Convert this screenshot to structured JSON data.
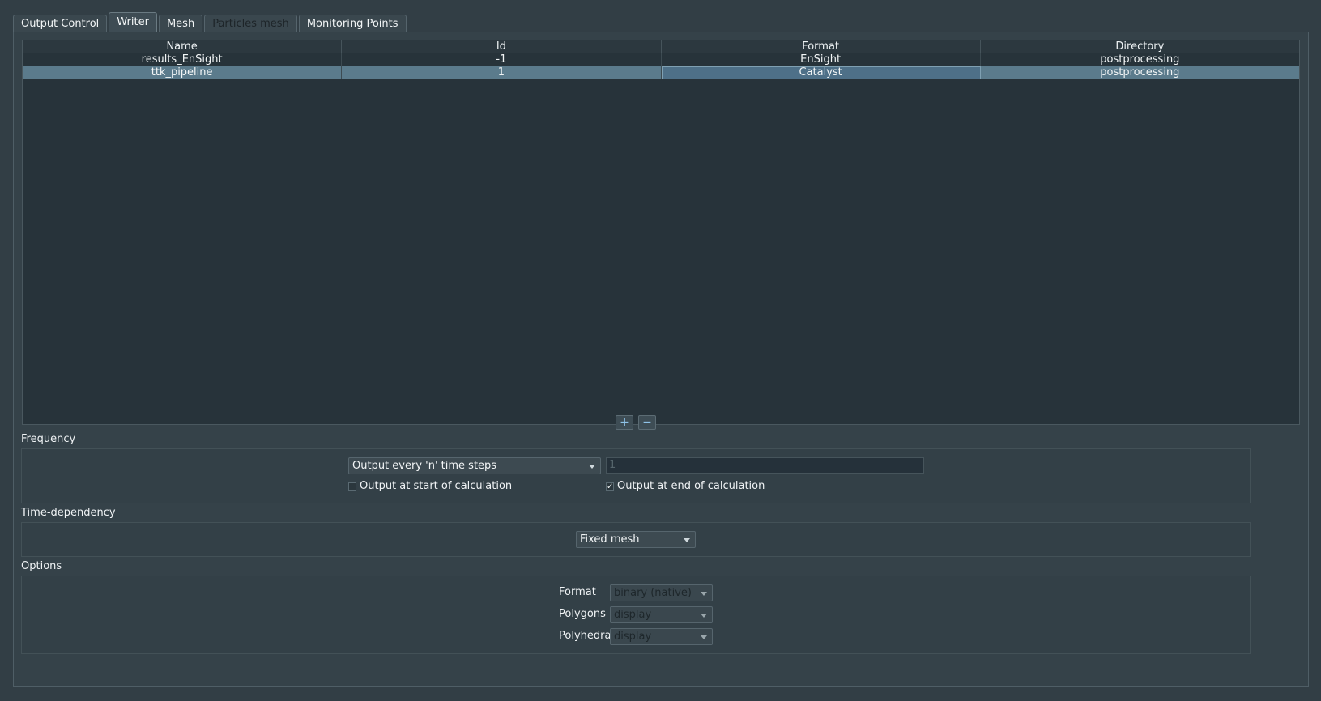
{
  "tabs": [
    {
      "label": "Output Control",
      "state": "normal"
    },
    {
      "label": "Writer",
      "state": "active"
    },
    {
      "label": "Mesh",
      "state": "normal"
    },
    {
      "label": "Particles mesh",
      "state": "disabled"
    },
    {
      "label": "Monitoring Points",
      "state": "normal"
    }
  ],
  "writer_table": {
    "columns": [
      "Name",
      "Id",
      "Format",
      "Directory"
    ],
    "rows": [
      [
        "results_EnSight",
        "-1",
        "EnSight",
        "postprocessing"
      ],
      [
        "ttk_pipeline",
        "1",
        "Catalyst",
        "postprocessing"
      ]
    ],
    "selected_row": 1
  },
  "buttons": {
    "add": "+",
    "remove": "−"
  },
  "frequency": {
    "title": "Frequency",
    "mode": "Output every 'n' time steps",
    "n_value": "1",
    "start_label": "Output at start of calculation",
    "start_checked": false,
    "end_label": "Output at end of calculation",
    "end_checked": true,
    "end_mark": "✓"
  },
  "time_dependency": {
    "title": "Time-dependency",
    "value": "Fixed mesh"
  },
  "options": {
    "title": "Options",
    "format_label": "Format",
    "format_value": "binary (native)",
    "polygons_label": "Polygons",
    "polygons_value": "display",
    "polyhedra_label": "Polyhedra",
    "polyhedra_value": "display"
  }
}
